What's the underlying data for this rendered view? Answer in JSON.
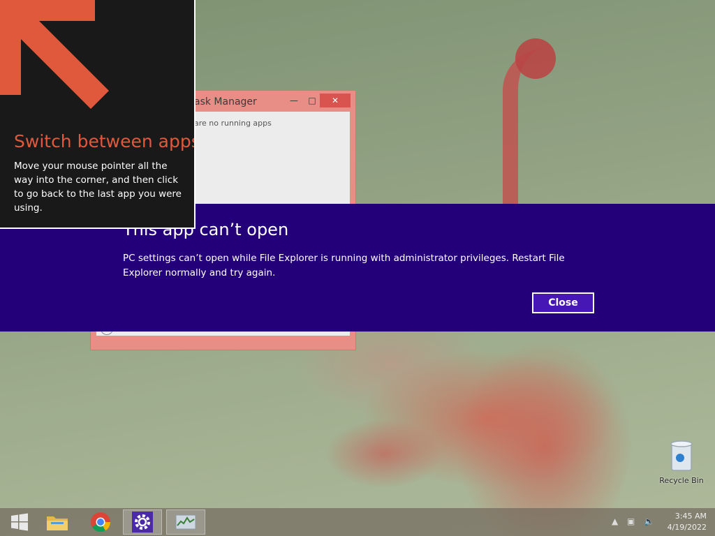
{
  "hint": {
    "title": "Switch between apps",
    "body": "Move your mouse pointer all the way into the corner, and then click to go back to the last app you were using."
  },
  "task_manager": {
    "title": "ask Manager",
    "empty_text": "are no running apps"
  },
  "banner": {
    "title": "This app can’t open",
    "message": "PC settings can’t open while File Explorer is running with administrator privileges. Restart File Explorer normally and try again.",
    "close_label": "Close"
  },
  "desktop": {
    "recycle_bin_label": "Recycle Bin"
  },
  "taskbar": {
    "items": [
      {
        "name": "start",
        "icon": "windows-logo-icon"
      },
      {
        "name": "file-explorer",
        "icon": "folder-icon"
      },
      {
        "name": "chrome",
        "icon": "chrome-icon"
      },
      {
        "name": "pc-settings",
        "icon": "gear-icon"
      },
      {
        "name": "task-manager",
        "icon": "task-manager-icon"
      }
    ],
    "time": "3:45 AM",
    "date": "4/19/2022"
  },
  "colors": {
    "banner_bg": "#23007a",
    "close_button_bg": "#4617b4",
    "hint_title": "#e1593d",
    "arrow": "#e1593d"
  }
}
